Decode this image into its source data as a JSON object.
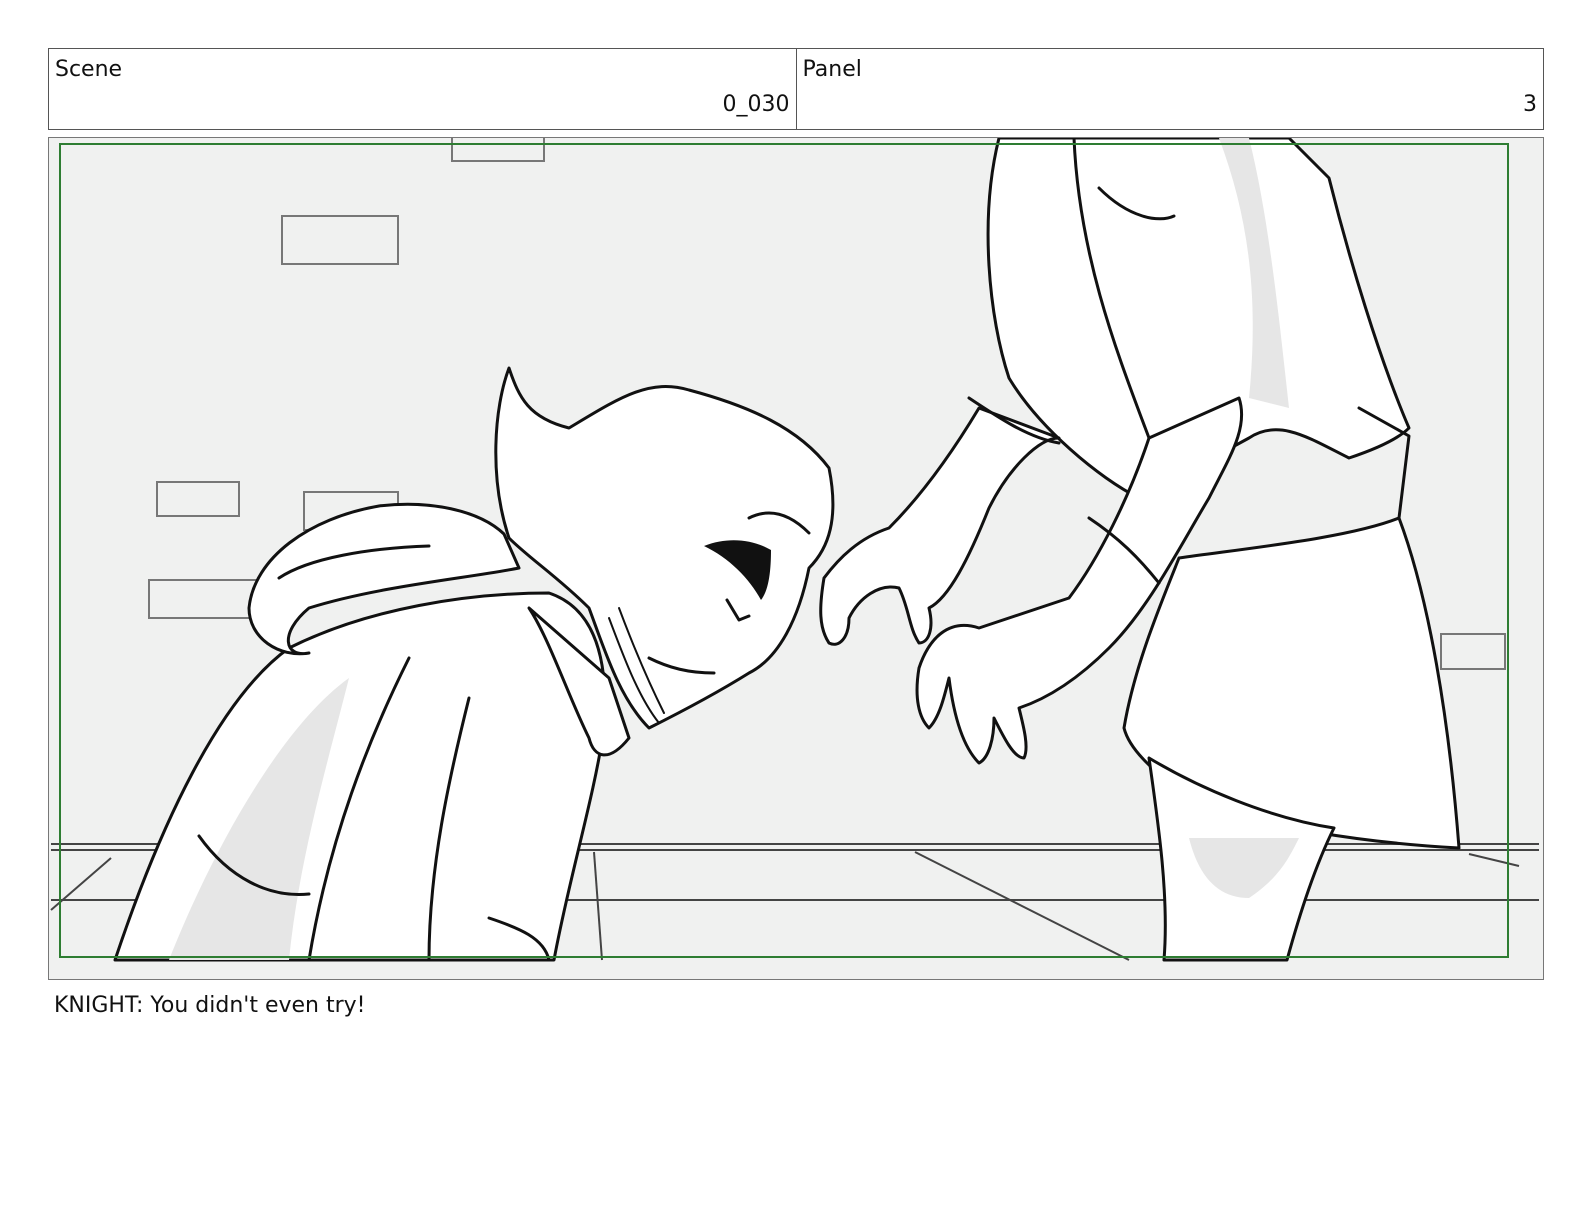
{
  "header": {
    "scene_label": "Scene",
    "scene_value": "0_030",
    "panel_label": "Panel",
    "panel_value": "3"
  },
  "panel": {
    "safe_area_color": "#2e7d32",
    "background_color": "#f0f1f0"
  },
  "dialogue": "KNIGHT: You didn't even try!"
}
